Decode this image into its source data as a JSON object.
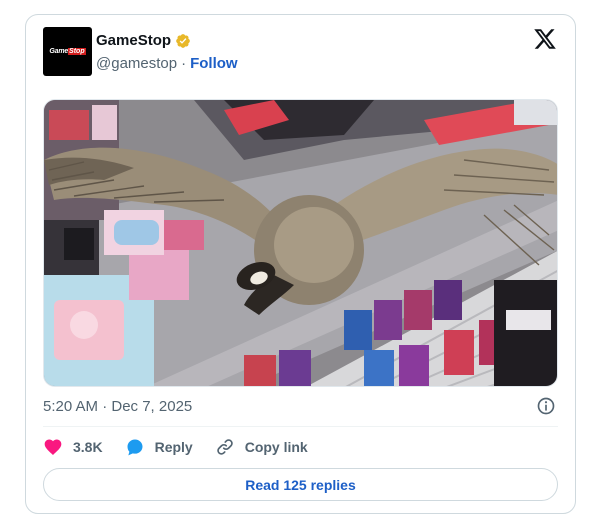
{
  "account": {
    "logo_text_game": "Game",
    "logo_text_stop": "Stop",
    "display_name": "GameStop",
    "handle": "@gamestop",
    "separator": "·",
    "follow_label": "Follow",
    "verified_badge_color": "#e8b829"
  },
  "post": {
    "image_description_icon": "photo",
    "timestamp": "5:20 AM · Dec 7, 2025"
  },
  "actions": {
    "like_count": "3.8K",
    "reply_label": "Reply",
    "copy_link_label": "Copy link"
  },
  "footer": {
    "read_replies_label": "Read 125 replies"
  },
  "colors": {
    "accent_blue": "#1d5fc7",
    "like_pink": "#f91880",
    "reply_blue": "#1d9bf0",
    "muted_text": "#536471"
  },
  "icons": {
    "brand": "x-logo-icon",
    "info": "info-icon",
    "like": "heart-icon",
    "reply": "speech-bubble-icon",
    "copy": "link-icon"
  }
}
